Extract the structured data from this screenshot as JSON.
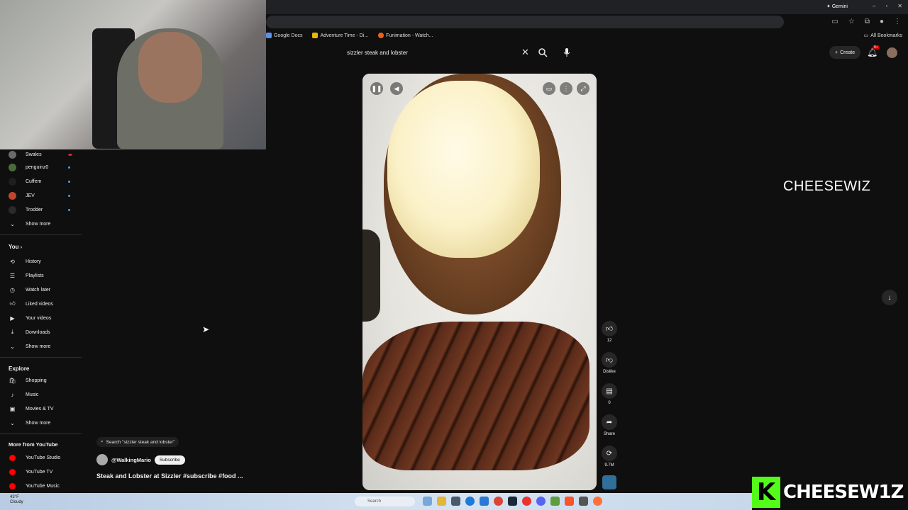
{
  "browser": {
    "gemini_label": "Gemini",
    "bookmarks": [
      "Google Docs",
      "Adventure Time - Di...",
      "Funimation - Watch..."
    ],
    "all_bookmarks": "All Bookmarks"
  },
  "topbar": {
    "search_query": "sizzler steak and lobster",
    "create_label": "Create",
    "notification_badge": "9+"
  },
  "sidebar": {
    "subscriptions": [
      {
        "name": "Swales",
        "avatar_color": "#6a6a6a"
      },
      {
        "name": "penguinz0",
        "avatar_color": "#4d6b3a"
      },
      {
        "name": "Cuffem",
        "avatar_color": "#1f1f1f"
      },
      {
        "name": "JEV",
        "avatar_color": "#c0452c"
      },
      {
        "name": "Trodder",
        "avatar_color": "#2a2a2a"
      }
    ],
    "subs_show_more": "Show more",
    "you_heading": "You",
    "you_items": [
      {
        "label": "History",
        "icon": "history-icon"
      },
      {
        "label": "Playlists",
        "icon": "playlists-icon"
      },
      {
        "label": "Watch later",
        "icon": "watch-later-icon"
      },
      {
        "label": "Liked videos",
        "icon": "like-icon"
      },
      {
        "label": "Your videos",
        "icon": "your-videos-icon"
      },
      {
        "label": "Downloads",
        "icon": "download-icon"
      }
    ],
    "you_show_more": "Show more",
    "explore_heading": "Explore",
    "explore_items": [
      {
        "label": "Shopping",
        "icon": "shopping-icon"
      },
      {
        "label": "Music",
        "icon": "music-icon"
      },
      {
        "label": "Movies & TV",
        "icon": "movies-icon"
      }
    ],
    "explore_show_more": "Show more",
    "more_heading": "More from YouTube",
    "more_items": [
      "YouTube Studio",
      "YouTube TV",
      "YouTube Music"
    ]
  },
  "short": {
    "search_chip": "Search \"sizzler steak and lobster\"",
    "channel": "@WalkingMario",
    "subscribe_label": "Subscribe",
    "title": "Steak and Lobster at Sizzler #subscribe #food ...",
    "likes": "12",
    "dislike_label": "Dislike",
    "comments": "0",
    "share_label": "Share",
    "remix_count": "9.7M"
  },
  "overlay": {
    "caption": "CHEESEWIZ",
    "brand_letter": "K",
    "brand_name": "CHEESEW1Z"
  },
  "taskbar": {
    "weather_temp": "43°F",
    "weather_desc": "Cloudy",
    "search_placeholder": "Search"
  },
  "colors": {
    "kick_green": "#53fc18",
    "yt_red": "#ff0000",
    "accent_blue": "#3ea6ff"
  }
}
